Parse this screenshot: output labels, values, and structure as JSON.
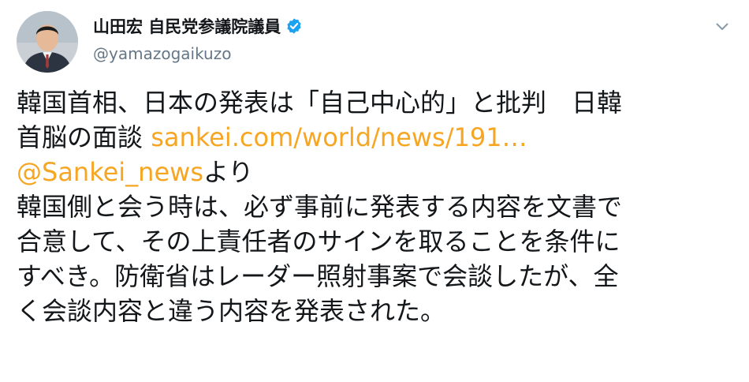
{
  "author": {
    "display_name": "山田宏 自民党参議院議員",
    "handle": "@yamazogaikuzo",
    "avatar": "avatar-photo",
    "verified_icon": "verified-badge-icon"
  },
  "menu_icon": "chevron-down-icon",
  "tweet": {
    "line1": "韓国首相、日本の発表は「自己中心的」と批判　日韓",
    "line2_prefix": "首脳の面談 ",
    "link_url": "sankei.com/world/news/191…",
    "mention": "@Sankei_news",
    "mention_suffix": "より",
    "line4": "韓国側と会う時は、必ず事前に発表する内容を文書で",
    "line5": "合意して、その上責任者のサインを取ることを条件に",
    "line6": "すべき。防衛省はレーダー照射事案で会談したが、全",
    "line7": "く会談内容と違う内容を発表された。"
  },
  "colors": {
    "link": "#f6a623",
    "verified": "#1da1f2",
    "text": "#14171a",
    "secondary": "#657786"
  }
}
